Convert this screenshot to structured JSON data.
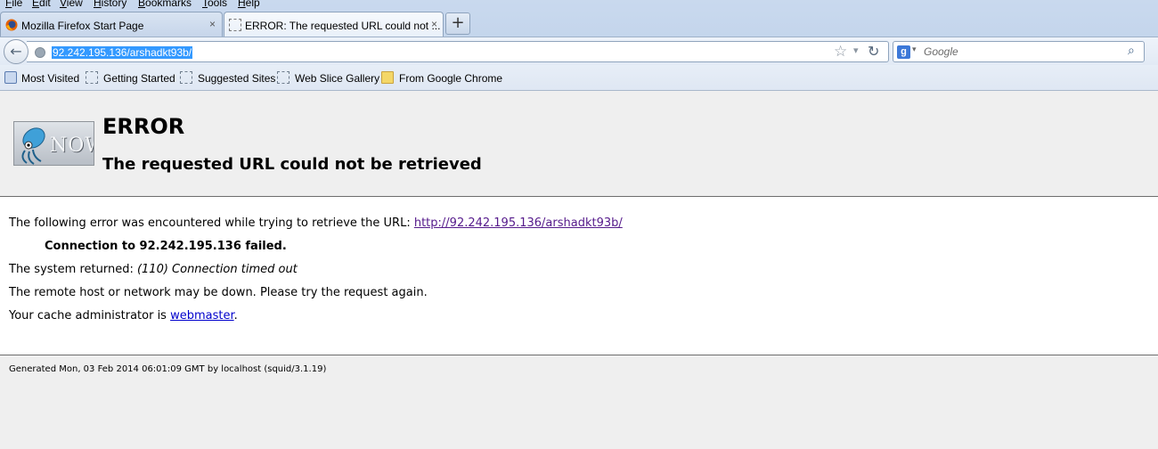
{
  "menubar": {
    "items": [
      {
        "accel": "F",
        "rest": "ile"
      },
      {
        "accel": "E",
        "rest": "dit"
      },
      {
        "accel": "V",
        "rest": "iew"
      },
      {
        "accel": "H",
        "rest": "istory"
      },
      {
        "accel": "B",
        "rest": "ookmarks"
      },
      {
        "accel": "T",
        "rest": "ools"
      },
      {
        "accel": "H",
        "rest": "elp"
      }
    ]
  },
  "tabs": [
    {
      "label": "Mozilla Firefox Start Page",
      "close": "×"
    },
    {
      "label": "ERROR: The requested URL could not ...",
      "close": "×"
    }
  ],
  "newtab": "+",
  "navbar": {
    "back": "←",
    "url": "92.242.195.136/arshadkt93b/",
    "star": "☆",
    "dropdown": "▾",
    "reload": "↻",
    "search_engine_icon": "g",
    "search_dropdown": "▾",
    "search_placeholder": "Google",
    "search_icon": "⌕"
  },
  "bookmarks": [
    {
      "label": "Most Visited",
      "icon": "most-visited-icon"
    },
    {
      "label": "Getting Started",
      "icon": "page-icon"
    },
    {
      "label": "Suggested Sites",
      "icon": "page-icon"
    },
    {
      "label": "Web Slice Gallery",
      "icon": "page-icon"
    },
    {
      "label": "From Google Chrome",
      "icon": "folder-icon"
    }
  ],
  "page": {
    "logo_text": "NOW",
    "heading": "ERROR",
    "subheading": "The requested URL could not be retrieved",
    "line1_prefix": "The following error was encountered while trying to retrieve the URL: ",
    "line1_link": "http://92.242.195.136/arshadkt93b/",
    "connection_failed": "Connection to 92.242.195.136 failed.",
    "system_prefix": "The system returned: ",
    "system_error": "(110) Connection timed out",
    "remote_host": "The remote host or network may be down. Please try the request again.",
    "admin_prefix": "Your cache administrator is ",
    "admin_link": "webmaster",
    "admin_suffix": ".",
    "footer": "Generated Mon, 03 Feb 2014 06:01:09 GMT by localhost (squid/3.1.19)"
  }
}
